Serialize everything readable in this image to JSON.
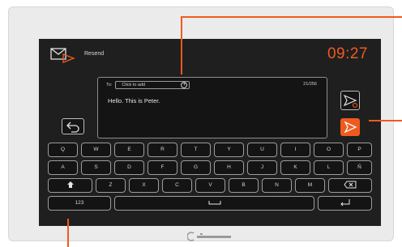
{
  "header": {
    "title": "Resend",
    "time": "09:27"
  },
  "compose": {
    "to_label": "To:",
    "to_placeholder": "Click to add",
    "counter": "21/256",
    "message": "Hello. This is Peter."
  },
  "keyboard": {
    "row1": [
      "Q",
      "W",
      "E",
      "R",
      "T",
      "Y",
      "U",
      "I",
      "O",
      "P"
    ],
    "row2": [
      "A",
      "S",
      "D",
      "F",
      "G",
      "H",
      "J",
      "K",
      "L",
      "Ñ"
    ],
    "row3": [
      "Z",
      "X",
      "C",
      "V",
      "B",
      "N",
      "M"
    ],
    "numeric_key": "123"
  },
  "colors": {
    "accent": "#f05a1e",
    "screen": "#1f1f1f",
    "frame": "#ebebeb"
  },
  "icons": {
    "resend": "envelope-forward-icon",
    "back": "return-arrow-icon",
    "resend_button": "send-outline-icon",
    "send_button": "send-icon",
    "shift": "shift-icon",
    "backspace": "backspace-icon",
    "space": "space-icon",
    "enter": "enter-icon"
  }
}
